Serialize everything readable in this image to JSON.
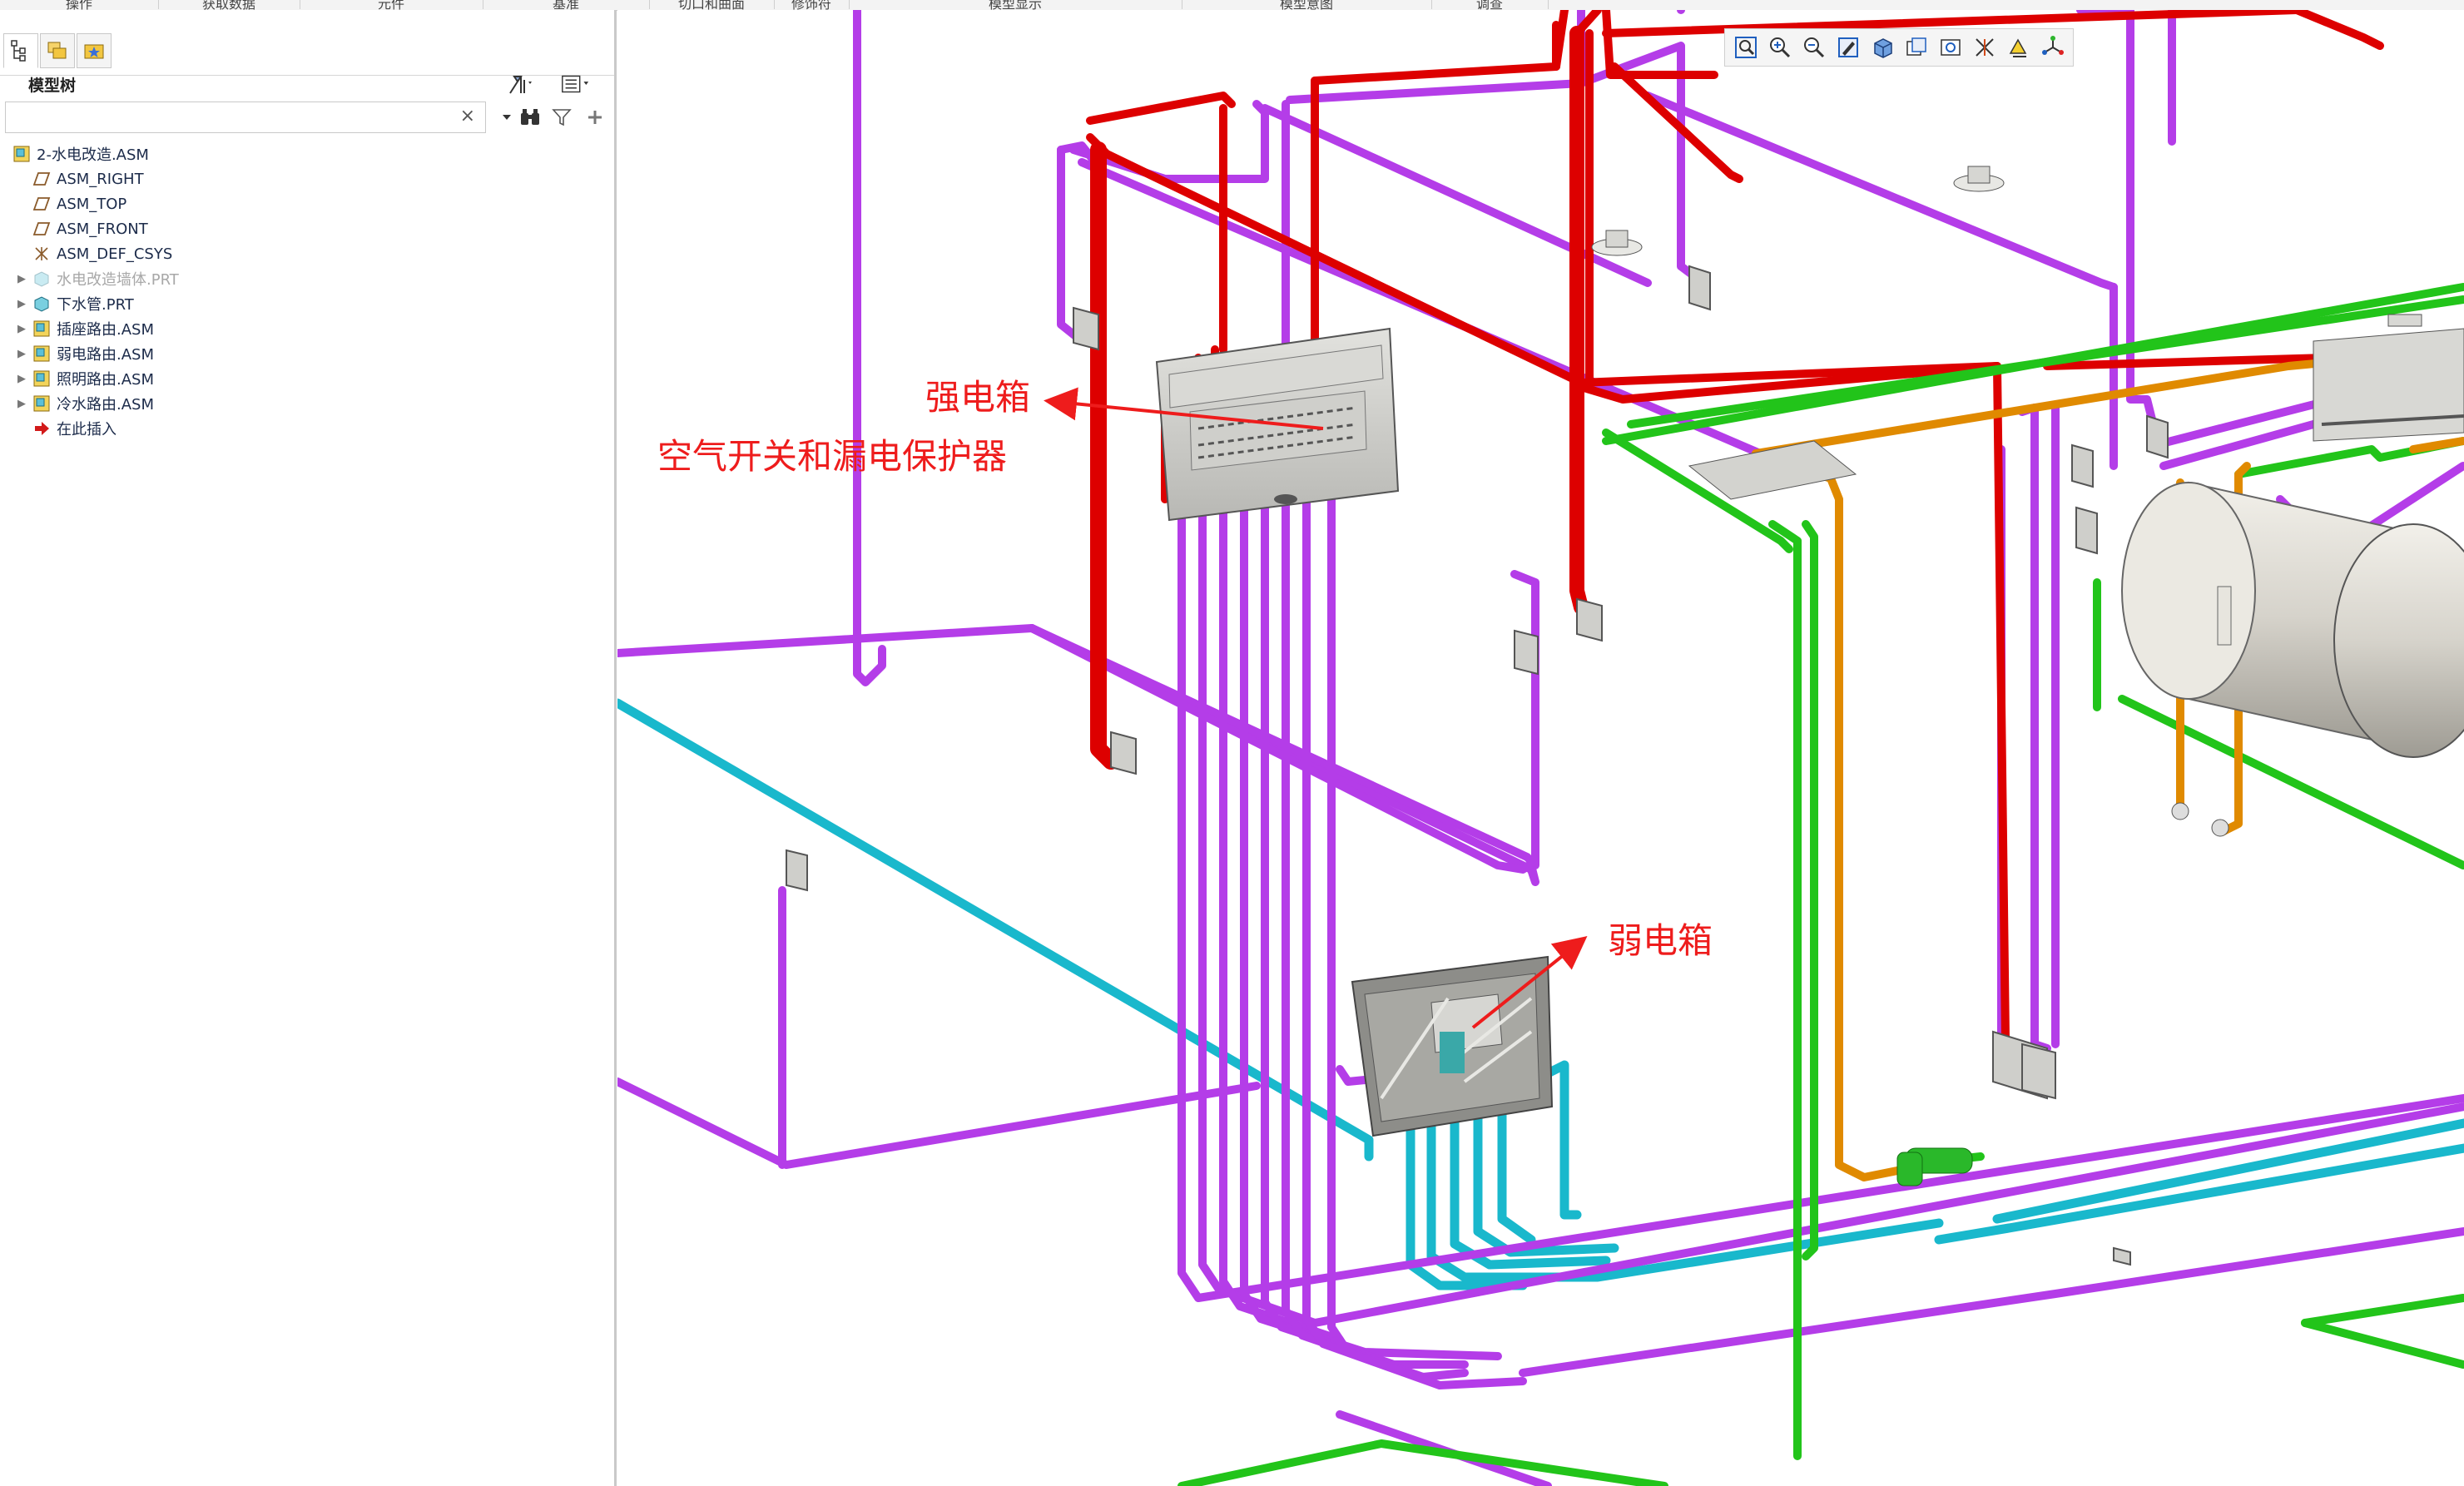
{
  "toolbar_groups": [
    "操作",
    "获取数据",
    "元件",
    "基准",
    "切口和曲面",
    "修饰符",
    "模型显示",
    "模型意图",
    "调查"
  ],
  "panel": {
    "title": "模型树",
    "search_placeholder": "",
    "clear_glyph": "×"
  },
  "tree": {
    "items": [
      {
        "label": "2-水电改造.ASM",
        "icon": "assembly-icon",
        "expander": "",
        "indent": 0,
        "dim": false
      },
      {
        "label": "ASM_RIGHT",
        "icon": "datum-plane-icon",
        "expander": "",
        "indent": 1,
        "dim": false
      },
      {
        "label": "ASM_TOP",
        "icon": "datum-plane-icon",
        "expander": "",
        "indent": 1,
        "dim": false
      },
      {
        "label": "ASM_FRONT",
        "icon": "datum-plane-icon",
        "expander": "",
        "indent": 1,
        "dim": false
      },
      {
        "label": "ASM_DEF_CSYS",
        "icon": "csys-icon",
        "expander": "",
        "indent": 1,
        "dim": false
      },
      {
        "label": "水电改造墙体.PRT",
        "icon": "part-icon",
        "expander": "▶",
        "indent": 1,
        "dim": true
      },
      {
        "label": "下水管.PRT",
        "icon": "part-icon",
        "expander": "▶",
        "indent": 1,
        "dim": false
      },
      {
        "label": "插座路由.ASM",
        "icon": "assembly-icon",
        "expander": "▶",
        "indent": 1,
        "dim": false
      },
      {
        "label": "弱电路由.ASM",
        "icon": "assembly-icon",
        "expander": "▶",
        "indent": 1,
        "dim": false
      },
      {
        "label": "照明路由.ASM",
        "icon": "assembly-icon",
        "expander": "▶",
        "indent": 1,
        "dim": false
      },
      {
        "label": "冷水路由.ASM",
        "icon": "assembly-icon",
        "expander": "▶",
        "indent": 1,
        "dim": false
      },
      {
        "label": "在此插入",
        "icon": "insert-here-icon",
        "expander": "",
        "indent": 1,
        "dim": false
      }
    ]
  },
  "view_toolbar": [
    "refit-icon",
    "zoom-in-icon",
    "zoom-out-icon",
    "repaint-icon",
    "display-style-icon",
    "saved-views-icon",
    "view-manager-icon",
    "datum-display-icon",
    "annotation-display-icon",
    "spin-center-icon"
  ],
  "annotations": {
    "strong_box": "强电箱",
    "breakers": "空气开关和漏电保护器",
    "weak_box": "弱电箱"
  },
  "colors": {
    "power": "#dd0000",
    "socket": "#b43de8",
    "water": "#19b8cc",
    "lighting": "#22c41a",
    "hot_water": "#e08a00",
    "annotation": "#ee1c1c"
  }
}
